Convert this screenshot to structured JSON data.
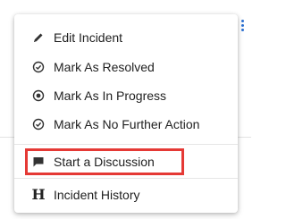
{
  "menu": {
    "items": [
      {
        "id": "edit",
        "label": "Edit Incident",
        "icon": "pencil-icon"
      },
      {
        "id": "resolved",
        "label": "Mark As Resolved",
        "icon": "check-circle-icon"
      },
      {
        "id": "in_progress",
        "label": "Mark As In Progress",
        "icon": "radio-dot-icon"
      },
      {
        "id": "no_further",
        "label": "Mark As No Further Action",
        "icon": "check-circle-icon"
      },
      {
        "id": "discussion",
        "label": "Start a Discussion",
        "icon": "chat-bubble-icon"
      },
      {
        "id": "history",
        "label": "Incident History",
        "icon": "h-letter-icon",
        "icon_text": "H"
      }
    ],
    "highlighted_item": "discussion"
  },
  "colors": {
    "highlight": "#e53935",
    "kebab": "#2a6fd1",
    "text": "#212121"
  }
}
